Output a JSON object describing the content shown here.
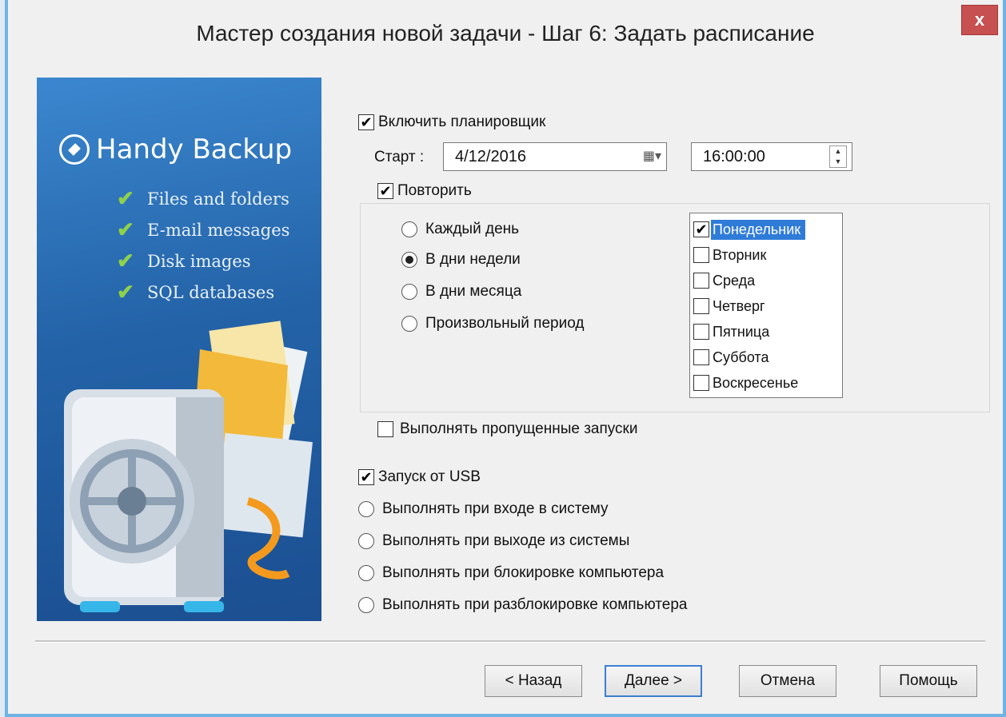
{
  "window": {
    "title": "Мастер создания новой задачи - Шаг 6: Задать расписание",
    "close_label": "x"
  },
  "banner": {
    "brand": "Handy Backup",
    "features": [
      "Files and folders",
      "E-mail messages",
      "Disk images",
      "SQL databases"
    ]
  },
  "scheduler": {
    "enable_label": "Включить планировщик",
    "start_label": "Старт :",
    "start_date": "4/12/2016",
    "start_time": "16:00:00",
    "repeat_label": "Повторить",
    "modes": [
      "Каждый день",
      "В дни недели",
      "В дни месяца",
      "Произвольный период"
    ],
    "days": [
      "Понедельник",
      "Вторник",
      "Среда",
      "Четверг",
      "Пятница",
      "Суббота",
      "Воскресенье"
    ],
    "missed_label": "Выполнять пропущенные запуски"
  },
  "triggers": {
    "usb_label": "Запуск от USB",
    "options": [
      "Выполнять при входе в систему",
      "Выполнять при выходе из системы",
      "Выполнять при блокировке компьютера",
      "Выполнять при разблокировке компьютера"
    ]
  },
  "buttons": {
    "back": "< Назад",
    "next": "Далее >",
    "cancel": "Отмена",
    "help": "Помощь"
  }
}
